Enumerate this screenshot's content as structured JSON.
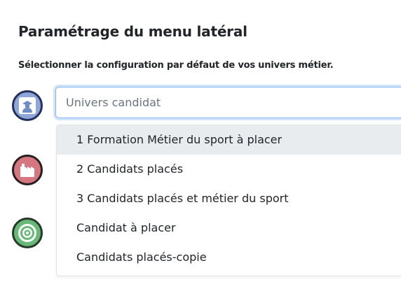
{
  "page": {
    "title": "Paramétrage du menu latéral",
    "subtitle": "Sélectionner la configuration par défaut de vos univers métier."
  },
  "univers_icons": [
    {
      "icon": "candidate-graduate-icon",
      "color": "#8ea6d8"
    },
    {
      "icon": "factory-icon",
      "color": "#d57680"
    },
    {
      "icon": "target-icon",
      "color": "#68b877"
    }
  ],
  "select": {
    "value": "Univers candidat",
    "options": [
      {
        "label": "1 Formation Métier du sport à placer",
        "highlighted": true
      },
      {
        "label": "2 Candidats placés",
        "highlighted": false
      },
      {
        "label": "3 Candidats placés et métier du sport",
        "highlighted": false
      },
      {
        "label": "Candidat à placer",
        "highlighted": false
      },
      {
        "label": "Candidats placés-copie",
        "highlighted": false
      }
    ]
  }
}
